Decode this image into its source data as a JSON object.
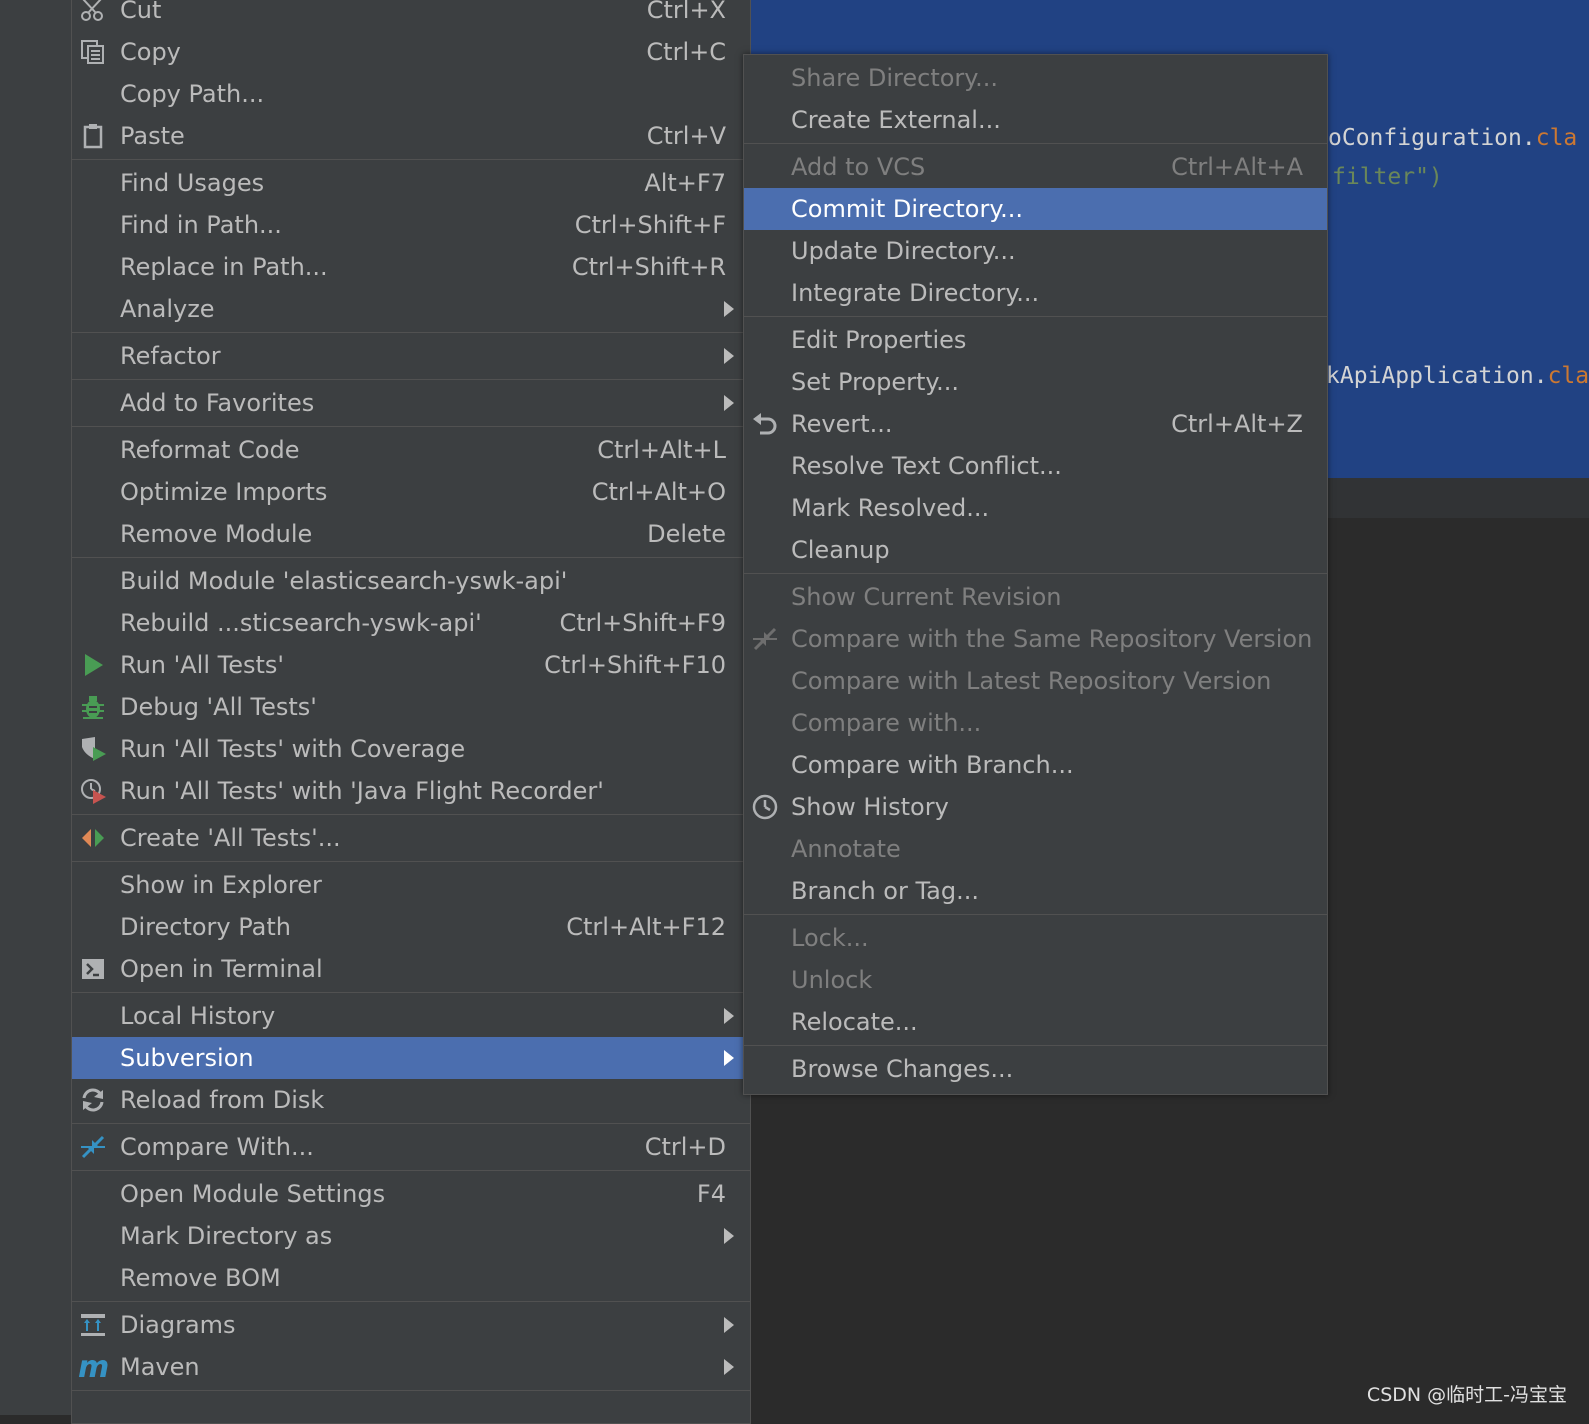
{
  "editor": {
    "code_line_1_a": "oConfiguration.",
    "code_line_1_b": "cla",
    "code_line_2_b": "filter\")",
    "code_line_3_a": "kApiApplication.",
    "code_line_3_b": "cla"
  },
  "main_menu": {
    "cut": {
      "label": "Cut",
      "shortcut": "Ctrl+X"
    },
    "copy": {
      "label": "Copy",
      "shortcut": "Ctrl+C"
    },
    "copy_path": {
      "label": "Copy Path..."
    },
    "paste": {
      "label": "Paste",
      "shortcut": "Ctrl+V"
    },
    "find_usages": {
      "label": "Find Usages",
      "shortcut": "Alt+F7"
    },
    "find_in_path": {
      "label": "Find in Path...",
      "shortcut": "Ctrl+Shift+F"
    },
    "replace_in_path": {
      "label": "Replace in Path...",
      "shortcut": "Ctrl+Shift+R"
    },
    "analyze": {
      "label": "Analyze"
    },
    "refactor": {
      "label": "Refactor"
    },
    "add_to_favorites": {
      "label": "Add to Favorites"
    },
    "reformat_code": {
      "label": "Reformat Code",
      "shortcut": "Ctrl+Alt+L"
    },
    "optimize_imports": {
      "label": "Optimize Imports",
      "shortcut": "Ctrl+Alt+O"
    },
    "remove_module": {
      "label": "Remove Module",
      "shortcut": "Delete"
    },
    "build_module": {
      "label": "Build Module 'elasticsearch-yswk-api'"
    },
    "rebuild": {
      "label": "Rebuild ...sticsearch-yswk-api'",
      "shortcut": "Ctrl+Shift+F9"
    },
    "run_all_tests": {
      "label": "Run 'All Tests'",
      "shortcut": "Ctrl+Shift+F10"
    },
    "debug_all_tests": {
      "label": "Debug 'All Tests'"
    },
    "run_coverage": {
      "label": "Run 'All Tests' with Coverage"
    },
    "run_jfr": {
      "label": "Run 'All Tests' with 'Java Flight Recorder'"
    },
    "create_all_tests": {
      "label": "Create 'All Tests'..."
    },
    "show_in_explorer": {
      "label": "Show in Explorer"
    },
    "directory_path": {
      "label": "Directory Path",
      "shortcut": "Ctrl+Alt+F12"
    },
    "open_in_terminal": {
      "label": "Open in Terminal"
    },
    "local_history": {
      "label": "Local History"
    },
    "subversion": {
      "label": "Subversion"
    },
    "reload_from_disk": {
      "label": "Reload from Disk"
    },
    "compare_with": {
      "label": "Compare With...",
      "shortcut": "Ctrl+D"
    },
    "open_module_settings": {
      "label": "Open Module Settings",
      "shortcut": "F4"
    },
    "mark_directory_as": {
      "label": "Mark Directory as"
    },
    "remove_bom": {
      "label": "Remove BOM"
    },
    "diagrams": {
      "label": "Diagrams"
    },
    "maven": {
      "label": "Maven"
    }
  },
  "sub_menu": {
    "share_directory": {
      "label": "Share Directory..."
    },
    "create_external": {
      "label": "Create External..."
    },
    "add_to_vcs": {
      "label": "Add to VCS",
      "shortcut": "Ctrl+Alt+A"
    },
    "commit_directory": {
      "label": "Commit Directory..."
    },
    "update_directory": {
      "label": "Update Directory..."
    },
    "integrate_directory": {
      "label": "Integrate Directory..."
    },
    "edit_properties": {
      "label": "Edit Properties"
    },
    "set_property": {
      "label": "Set Property..."
    },
    "revert": {
      "label": "Revert...",
      "shortcut": "Ctrl+Alt+Z"
    },
    "resolve_text_conflict": {
      "label": "Resolve Text Conflict..."
    },
    "mark_resolved": {
      "label": "Mark Resolved..."
    },
    "cleanup": {
      "label": "Cleanup"
    },
    "show_current_revision": {
      "label": "Show Current Revision"
    },
    "compare_same_repo": {
      "label": "Compare with the Same Repository Version"
    },
    "compare_latest_repo": {
      "label": "Compare with Latest Repository Version"
    },
    "compare_with": {
      "label": "Compare with..."
    },
    "compare_with_branch": {
      "label": "Compare with Branch..."
    },
    "show_history": {
      "label": "Show History"
    },
    "annotate": {
      "label": "Annotate"
    },
    "branch_or_tag": {
      "label": "Branch or Tag..."
    },
    "lock": {
      "label": "Lock..."
    },
    "unlock": {
      "label": "Unlock"
    },
    "relocate": {
      "label": "Relocate..."
    },
    "browse_changes": {
      "label": "Browse Changes..."
    }
  },
  "colors": {
    "menu_bg": "#3c3f41",
    "selection": "#4b6eaf",
    "editor_selection": "#214283",
    "text": "#bbbbbb",
    "disabled_text": "#7f7f7f"
  },
  "watermark": "CSDN @临时工-冯宝宝"
}
